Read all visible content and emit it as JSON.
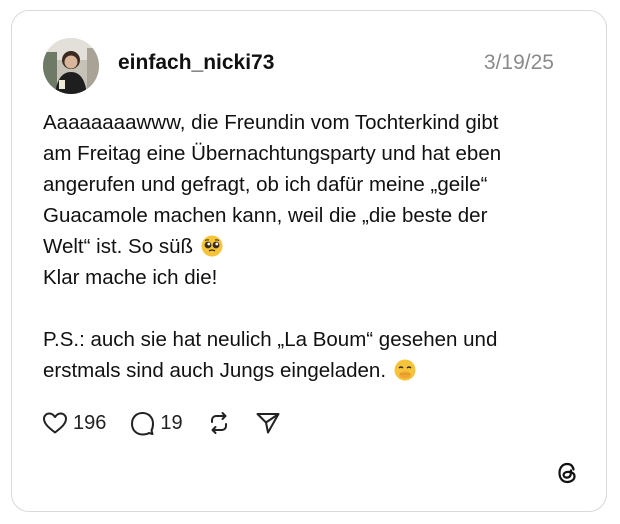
{
  "post": {
    "username": "einfach_nicki73",
    "date": "3/19/25",
    "lines": [
      "Aaaaaaaawww, die Freundin vom Tochterkind gibt",
      "am Freitag eine Übernachtungsparty und hat eben",
      "angerufen und gefragt, ob ich dafür meine „geile“",
      "Guacamole machen kann, weil die „die beste der",
      "Welt“ ist. So süß",
      "Klar mache ich die!",
      "P.S.: auch sie hat neulich „La Boum“ gesehen und",
      "erstmals sind auch Jungs eingeladen."
    ],
    "emojis": [
      "pleading-face-emoji",
      "smiling-face-with-hand-over-mouth-emoji"
    ]
  },
  "actions": {
    "likes": "196",
    "replies": "19",
    "icons": [
      "heart-icon",
      "comment-icon",
      "repost-icon",
      "share-icon"
    ]
  },
  "brand": {
    "logo": "threads-logo-icon",
    "text_color": "#111111",
    "date_color": "#8a8a8a"
  }
}
